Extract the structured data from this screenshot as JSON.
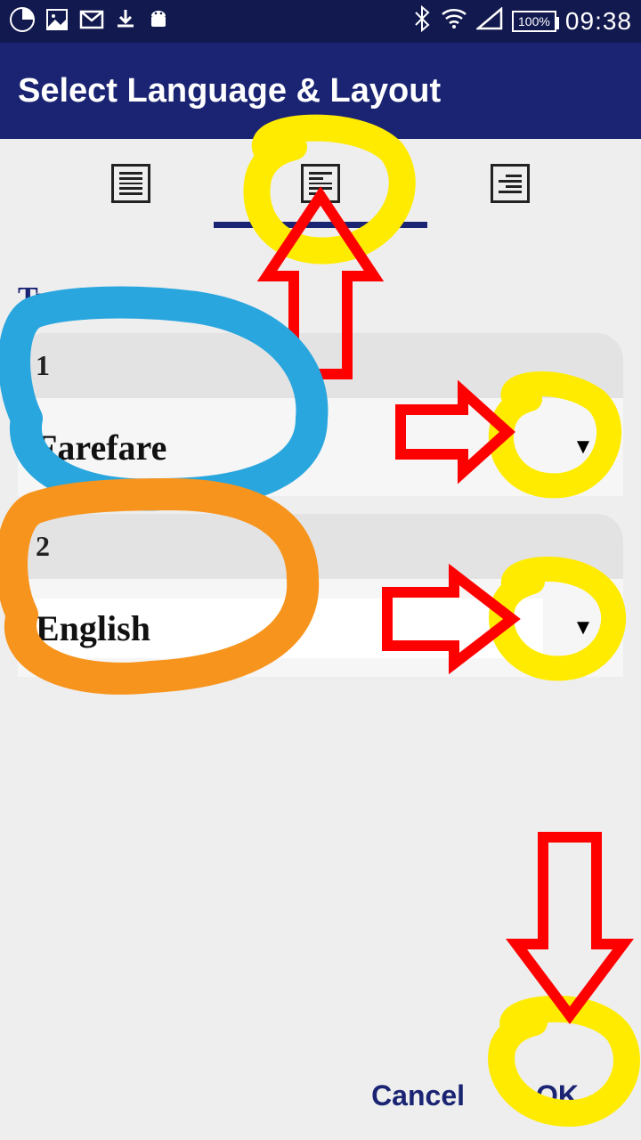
{
  "statusbar": {
    "battery": "100%",
    "clock": "09:38"
  },
  "appbar": {
    "title": "Select Language & Layout"
  },
  "section": {
    "title": "Two Pane"
  },
  "panes": [
    {
      "num": "1",
      "lang": "Farefare"
    },
    {
      "num": "2",
      "lang": "English"
    }
  ],
  "footer": {
    "cancel": "Cancel",
    "ok": "OK"
  }
}
